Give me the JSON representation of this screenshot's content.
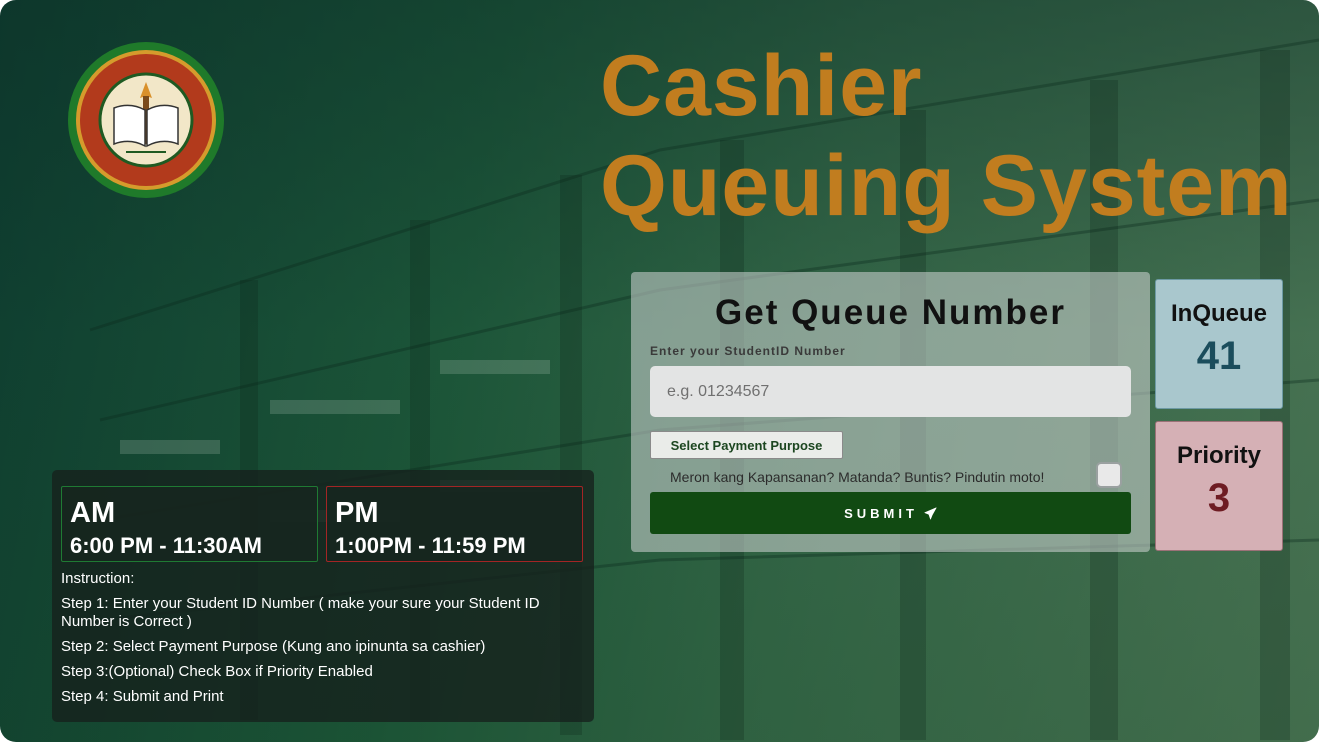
{
  "header": {
    "title_line1": "Cashier",
    "title_line2": "Queuing System"
  },
  "logo": {
    "name": "GENERAL DE JESUS COLLEGE",
    "location": "SAN ISIDRO, NUEVA ECIJA",
    "motto": "For God and country",
    "year": "1946",
    "icon": "college-seal-icon"
  },
  "queue_form": {
    "heading": "Get Queue Number",
    "student_id_label": "Enter your StudentID Number",
    "student_id_placeholder": "e.g. 01234567",
    "student_id_value": "",
    "payment_purpose_button": "Select Payment Purpose",
    "priority_checkbox_label": "Meron kang Kapansanan? Matanda? Buntis? Pindutin moto!",
    "priority_checked": false,
    "submit_label": "SUBMIT",
    "submit_icon": "paper-plane-icon"
  },
  "counters": {
    "inqueue": {
      "label": "InQueue",
      "value": "41"
    },
    "priority": {
      "label": "Priority",
      "value": "3"
    }
  },
  "schedule": {
    "am": {
      "label": "AM",
      "hours": "6:00 PM - 11:30AM"
    },
    "pm": {
      "label": "PM",
      "hours": "1:00PM - 11:59 PM"
    }
  },
  "instructions": {
    "title": "Instruction:",
    "steps": [
      "Step 1: Enter your Student ID Number ( make your sure your Student ID Number is Correct )",
      "Step 2: Select Payment Purpose (Kung ano ipinunta sa cashier)",
      "Step 3:(Optional) Check Box if Priority Enabled",
      "Step 4: Submit and Print"
    ]
  },
  "colors": {
    "title": "#c17d1f",
    "submit_button": "#114a12",
    "inqueue_box": "#a9c7cd",
    "priority_box": "#d5b0b5",
    "am_border": "#1f7a33",
    "pm_border": "#a32525"
  }
}
